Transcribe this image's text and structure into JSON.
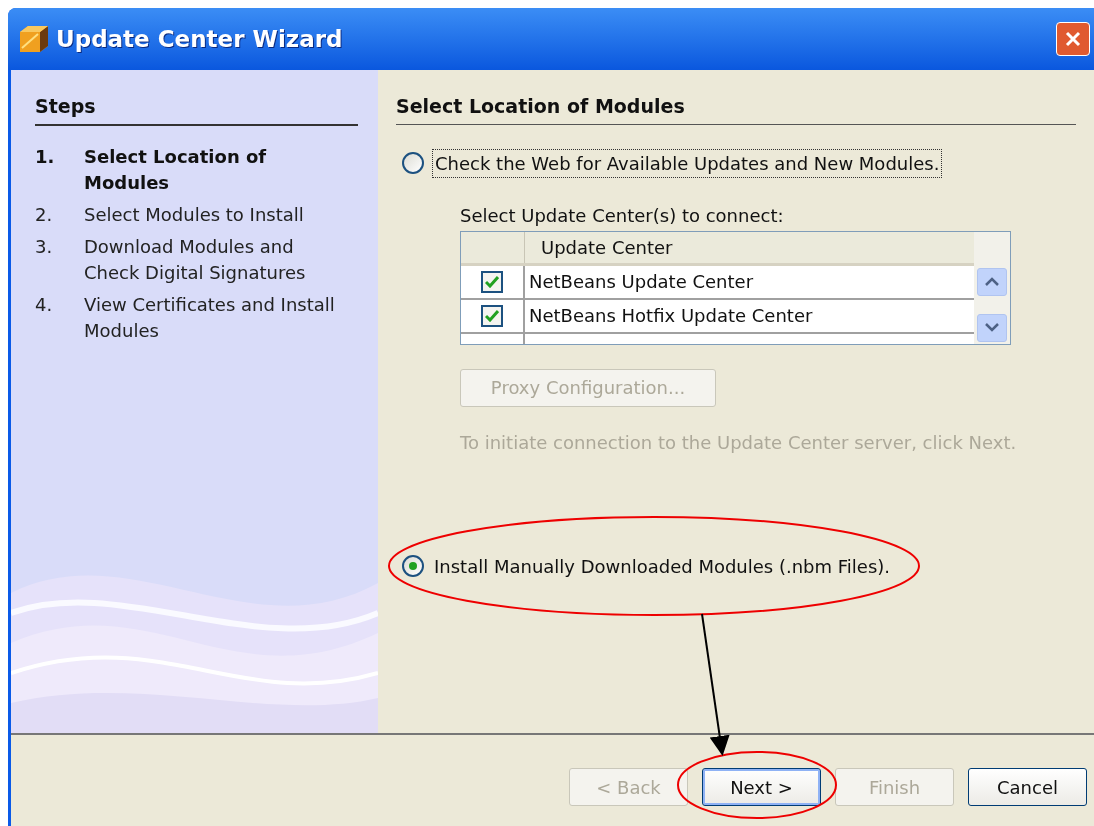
{
  "window": {
    "title": "Update Center Wizard"
  },
  "steps": {
    "title": "Steps",
    "items": [
      {
        "number": "1.",
        "label": "Select Location of Modules",
        "selected": true
      },
      {
        "number": "2.",
        "label": "Select Modules to Install",
        "selected": false
      },
      {
        "number": "3.",
        "label": "Download Modules and Check Digital Signatures",
        "selected": false
      },
      {
        "number": "4.",
        "label": "View Certificates and Install Modules",
        "selected": false
      }
    ]
  },
  "panel": {
    "title": "Select Location of Modules",
    "options": [
      {
        "label": "Check the Web for Available Updates and New Modules.",
        "selected": false
      },
      {
        "label": "Install Manually Downloaded Modules (.nbm Files).",
        "selected": true
      }
    ],
    "table_label": "Select Update Center(s) to connect:",
    "table": {
      "columns": [
        "Update Center"
      ],
      "rows": [
        {
          "name": "NetBeans Update Center",
          "checked": true
        },
        {
          "name": "NetBeans Hotfix Update Center",
          "checked": true
        }
      ]
    },
    "proxy_button": {
      "label": "Proxy Configuration...",
      "disabled": true
    },
    "hint": "To initiate connection to the Update Center server, click Next."
  },
  "buttons": [
    {
      "label": "< Back",
      "disabled": true,
      "default": false
    },
    {
      "label": "Next >",
      "disabled": false,
      "default": true
    },
    {
      "label": "Finish",
      "disabled": true,
      "default": false
    },
    {
      "label": "Cancel",
      "disabled": false,
      "default": false
    }
  ]
}
